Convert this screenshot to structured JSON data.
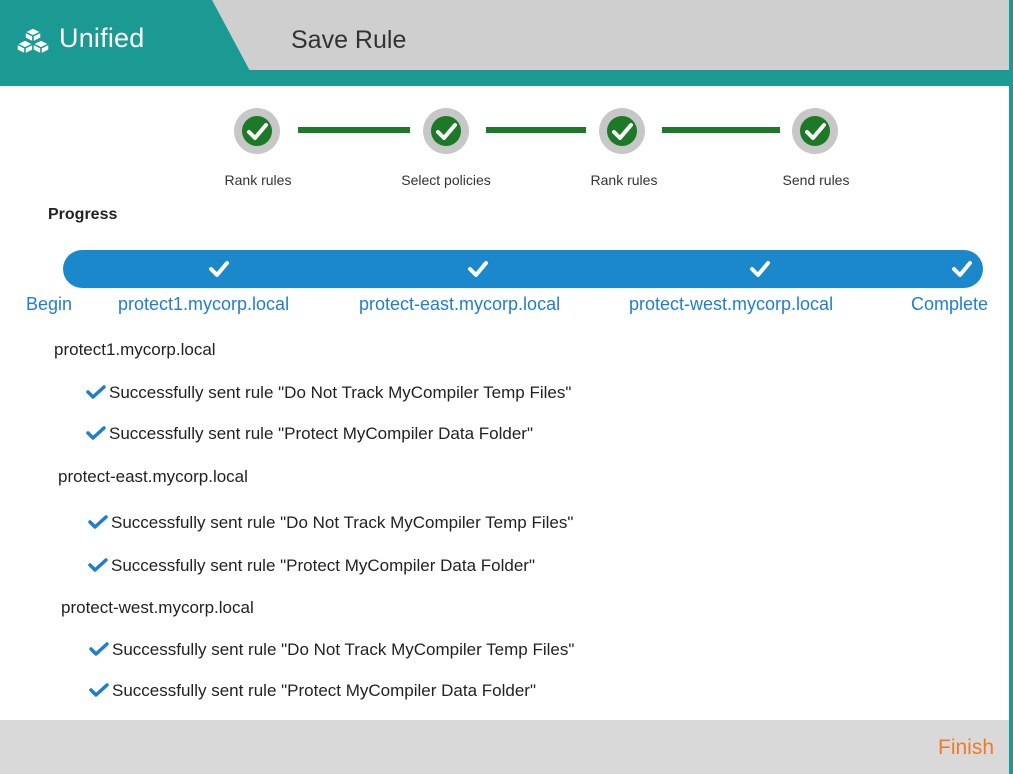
{
  "header": {
    "brand_icon": "cubes-icon",
    "brand_title": "Unified",
    "page_title": "Save Rule",
    "colors": {
      "teal": "#1b9a93",
      "gray": "#cfcfcf"
    }
  },
  "stepper": {
    "steps": [
      {
        "label": "Rank rules",
        "status": "complete"
      },
      {
        "label": "Select policies",
        "status": "complete"
      },
      {
        "label": "Rank rules",
        "status": "complete"
      },
      {
        "label": "Send rules",
        "status": "complete"
      }
    ],
    "colors": {
      "complete": "#1c7a27",
      "ring": "#c7c7c7"
    }
  },
  "progress": {
    "heading": "Progress",
    "fraction": 1.0,
    "color": "#1b88cc",
    "milestones": [
      "Begin",
      "protect1.mycorp.local",
      "protect-east.mycorp.local",
      "protect-west.mycorp.local",
      "Complete"
    ]
  },
  "results": [
    {
      "host": "protect1.mycorp.local",
      "messages": [
        "Successfully sent rule \"Do Not Track MyCompiler Temp Files\"",
        "Successfully sent rule \"Protect MyCompiler Data Folder\""
      ]
    },
    {
      "host": "protect-east.mycorp.local",
      "messages": [
        "Successfully sent rule \"Do Not Track MyCompiler Temp Files\"",
        "Successfully sent rule \"Protect MyCompiler Data Folder\""
      ]
    },
    {
      "host": "protect-west.mycorp.local",
      "messages": [
        "Successfully sent rule \"Do Not Track MyCompiler Temp Files\"",
        "Successfully sent rule \"Protect MyCompiler Data Folder\""
      ]
    }
  ],
  "footer": {
    "finish_label": "Finish",
    "finish_color": "#f07a2a"
  }
}
